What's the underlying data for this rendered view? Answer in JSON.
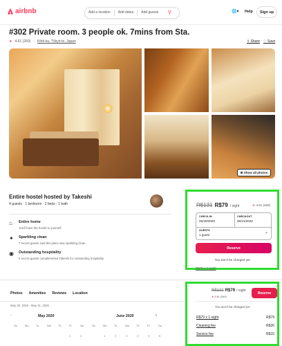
{
  "header": {
    "brand": "airbnb",
    "search": {
      "location": "Add a location",
      "dates": "Add dates",
      "guests": "Add guests"
    },
    "help": "Help",
    "signup": "Sign up"
  },
  "listing": {
    "title": "#302 Private room. 3 people ok. 7mins from Sta.",
    "rating": "4.61 (260)",
    "location": "Kōtō-ku, Tōkyō-to, Japan",
    "share": "Share",
    "save": "Save",
    "show_all_photos": "Show all photos"
  },
  "host": {
    "title": "Entire hostel hosted by Takeshi",
    "details": "4 guests · 1 bedroom · 2 beds · 1 bath"
  },
  "features": [
    {
      "title": "Entire home",
      "desc": "You'll have the hostel to yourself."
    },
    {
      "title": "Sparkling clean",
      "desc": "7 recent guests said this place was sparkling clean."
    },
    {
      "title": "Outstanding hospitality",
      "desc": "6 recent guests complimented Takeshi for outstanding hospitality."
    }
  ],
  "booking": {
    "old_price": "R$131",
    "price": "R$79",
    "per_night": "/ night",
    "rating": "4.61 (260)",
    "checkin_label": "CHECK-IN",
    "checkin_value": "05/30/2020",
    "checkout_label": "CHECKOUT",
    "checkout_value": "05/31/2020",
    "guests_label": "GUESTS",
    "guests_value": "1 guest",
    "reserve": "Reserve",
    "no_charge": "You won't be charged yet",
    "clipped_line": "R$79 x 1 night"
  },
  "section2": {
    "tabs": [
      "Photos",
      "Amenities",
      "Reviews",
      "Location"
    ],
    "date_range": "May 30, 2020 - May 31, 2020",
    "month1": "May 2020",
    "month2": "June 2020",
    "weekdays": [
      "Su",
      "Mo",
      "Tu",
      "We",
      "Th",
      "Fr",
      "Sa"
    ],
    "month1_days": [
      "1",
      "2"
    ],
    "month2_days": [
      "1",
      "2",
      "3",
      "4",
      "5",
      "6"
    ]
  },
  "booking2": {
    "old_price": "R$131",
    "price": "R$79",
    "per_night": "/ night",
    "rating": "4.61 (260)",
    "reserve": "Reserve",
    "no_charge": "You won't be charged yet",
    "rows": [
      {
        "label": "R$79 x 1 night",
        "value": "R$79"
      },
      {
        "label": "Cleaning fee",
        "value": "R$26"
      },
      {
        "label": "Service fee",
        "value": "R$15"
      }
    ]
  },
  "colors": {
    "brand": "#ff385c",
    "highlight": "#2fdc2f"
  }
}
